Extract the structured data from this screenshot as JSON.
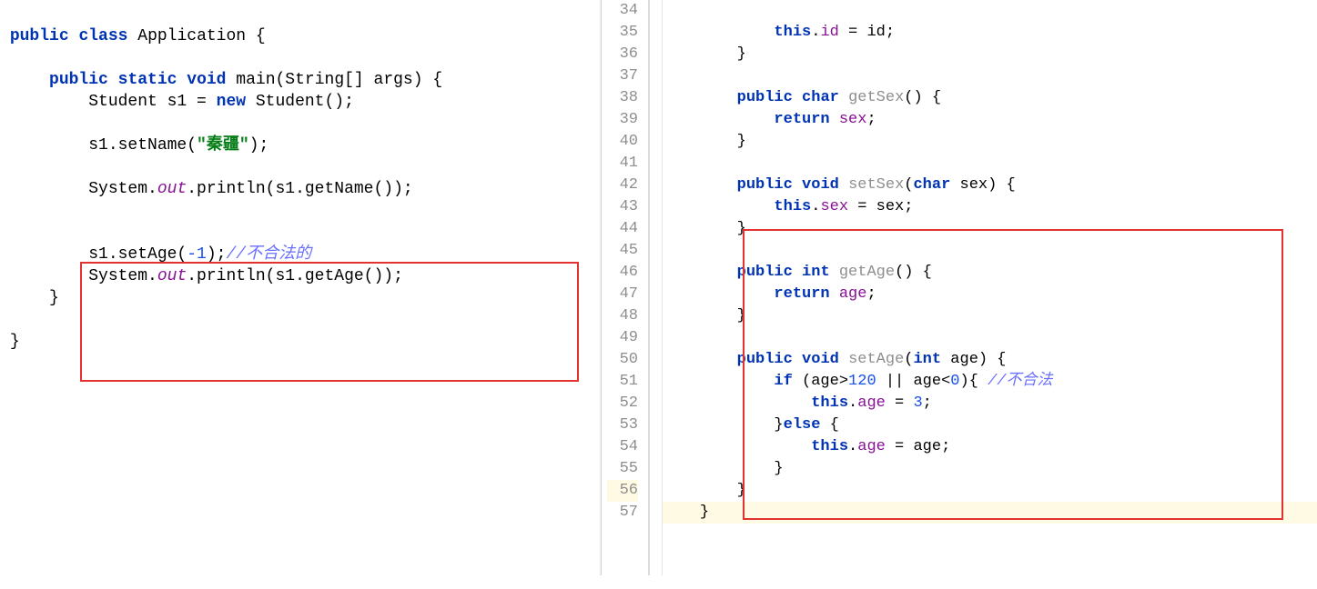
{
  "left": {
    "l1a": "public",
    "l1b": "class",
    "l1c": "Application {",
    "l3a": "public",
    "l3b": "static",
    "l3c": "void",
    "l3d": "main(String[] args) {",
    "l4a": "Student s1 = ",
    "l4b": "new",
    "l4c": " Student();",
    "l6": "s1.setName(",
    "l6s": "\"秦疆\"",
    "l6e": ");",
    "l8a": "System.",
    "l8b": "out",
    "l8c": ".println(s1.getName());",
    "l11a": "s1.setAge(",
    "l11n": "-1",
    "l11b": ");",
    "l11c": "//不合法的",
    "l12a": "System.",
    "l12b": "out",
    "l12c": ".println(s1.getAge());",
    "l13": "}",
    "l15": "}"
  },
  "right": {
    "line_numbers": [
      "34",
      "35",
      "36",
      "37",
      "38",
      "39",
      "40",
      "41",
      "42",
      "43",
      "44",
      "45",
      "46",
      "47",
      "48",
      "49",
      "50",
      "51",
      "52",
      "53",
      "54",
      "55",
      "56",
      "57"
    ],
    "r34a": "this",
    "r34b": ".",
    "r34f": "id",
    "r34c": " = id;",
    "r35": "}",
    "r37a": "public",
    "r37b": "char",
    "r37c": "getSex",
    "r37d": "() {",
    "r38a": "return ",
    "r38b": "sex",
    "r38c": ";",
    "r39": "}",
    "r41a": "public",
    "r41b": "void",
    "r41c": "setSex",
    "r41d": "(",
    "r41e": "char",
    "r41f": " sex) {",
    "r42a": "this",
    "r42b": ".",
    "r42f": "sex",
    "r42c": " = sex;",
    "r43": "}",
    "r45a": "public",
    "r45b": "int",
    "r45c": "getAge",
    "r45d": "() {",
    "r46a": "return ",
    "r46b": "age",
    "r46c": ";",
    "r47": "}",
    "r49a": "public",
    "r49b": "void",
    "r49c": "setAge",
    "r49d": "(",
    "r49e": "int",
    "r49f": " age) {",
    "r50a": "if ",
    "r50b": "(age>",
    "r50n1": "120",
    "r50c": " || age<",
    "r50n2": "0",
    "r50d": "){ ",
    "r50cm": "//不合法",
    "r51a": "this",
    "r51b": ".",
    "r51f": "age",
    "r51c": " = ",
    "r51n": "3",
    "r51d": ";",
    "r52a": "}",
    "r52b": "else",
    "r52c": " {",
    "r53a": "this",
    "r53b": ".",
    "r53f": "age",
    "r53c": " = age;",
    "r54": "}",
    "r55": "}",
    "r56": "}"
  }
}
